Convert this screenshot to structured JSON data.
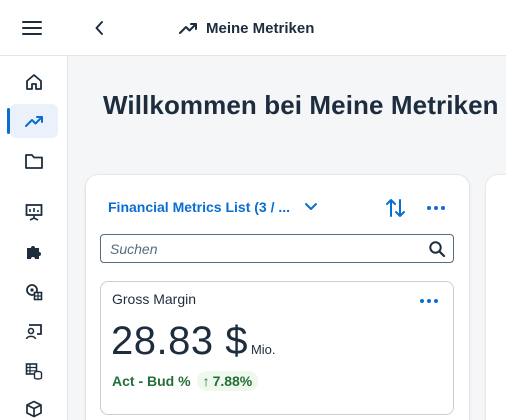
{
  "header": {
    "menu_icon": "hamburger-icon",
    "back_icon": "chevron-left-icon",
    "title_icon": "trend-up-icon",
    "title": "Meine Metriken"
  },
  "sidebar": {
    "items": [
      {
        "icon": "home-icon",
        "active": false
      },
      {
        "icon": "trend-up-icon",
        "active": true
      },
      {
        "icon": "folder-icon",
        "active": false
      },
      {
        "icon": "presentation-icon",
        "active": false
      },
      {
        "icon": "puzzle-icon",
        "active": false
      },
      {
        "icon": "settings-grid-icon",
        "active": false
      },
      {
        "icon": "user-screen-icon",
        "active": false
      },
      {
        "icon": "table-db-icon",
        "active": false
      },
      {
        "icon": "cube-icon",
        "active": false
      }
    ]
  },
  "main": {
    "welcome": "Willkommen bei Meine Metriken",
    "list": {
      "selected_label": "Financial Metrics List (3 / ...",
      "search_placeholder": "Suchen",
      "search_value": ""
    },
    "tile": {
      "title": "Gross Margin",
      "value": "28.83 $",
      "scale": "Mio.",
      "footer_label": "Act - Bud %",
      "delta_arrow": "↑",
      "delta_value": "7.88%"
    }
  },
  "colors": {
    "accent": "#0a6ed1",
    "text": "#1d2d3e",
    "positive": "#256f3a",
    "positive_bg": "#eef8ec",
    "background": "#f5f6f7"
  }
}
